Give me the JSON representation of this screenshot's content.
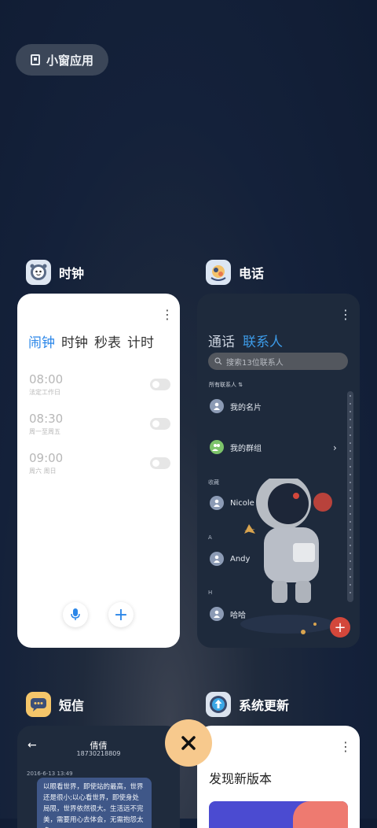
{
  "widget_pill": {
    "label": "小窗应用",
    "icon": "small-window-icon"
  },
  "clock": {
    "app_name": "时钟",
    "icon": "clock-app-icon",
    "tabs": [
      "闹钟",
      "时钟",
      "秒表",
      "计时"
    ],
    "active_tab": 0,
    "alarms": [
      {
        "time": "08:00",
        "repeat": "法定工作日",
        "enabled": false
      },
      {
        "time": "08:30",
        "repeat": "周一至周五",
        "enabled": false
      },
      {
        "time": "09:00",
        "repeat": "周六 周日",
        "enabled": false
      }
    ],
    "actions": [
      "mic-icon",
      "add-icon"
    ]
  },
  "contacts": {
    "app_name": "电话",
    "icon": "phone-app-icon",
    "tabs": [
      "通话",
      "联系人"
    ],
    "active_tab": 1,
    "search_placeholder": "搜索13位联系人",
    "filter_label": "所有联系人",
    "my_card": "我的名片",
    "my_groups": "我的群组",
    "section_favorites": "收藏",
    "favorite_1": "Nicole",
    "section_a": "A",
    "contact_a": "Andy",
    "section_h": "H",
    "contact_h": "哈哈",
    "fab_label": "+",
    "colors": {
      "accent": "#3d9be8",
      "fab": "#d3473b"
    }
  },
  "sms": {
    "app_name": "短信",
    "icon": "messages-app-icon",
    "contact_name": "倩倩",
    "contact_number": "18730218809",
    "date": "2016-6-13 13:49",
    "message": "以眼看世界，即使站的最高，世界还是很小;以心看世界，即使身处局限，世界依然很大。生活远不完美，需要用心去体会，无需抱怨太多。"
  },
  "updater": {
    "app_name": "系统更新",
    "icon": "system-update-app-icon",
    "title": "发现新版本"
  },
  "close_button": {
    "icon": "close-icon"
  }
}
